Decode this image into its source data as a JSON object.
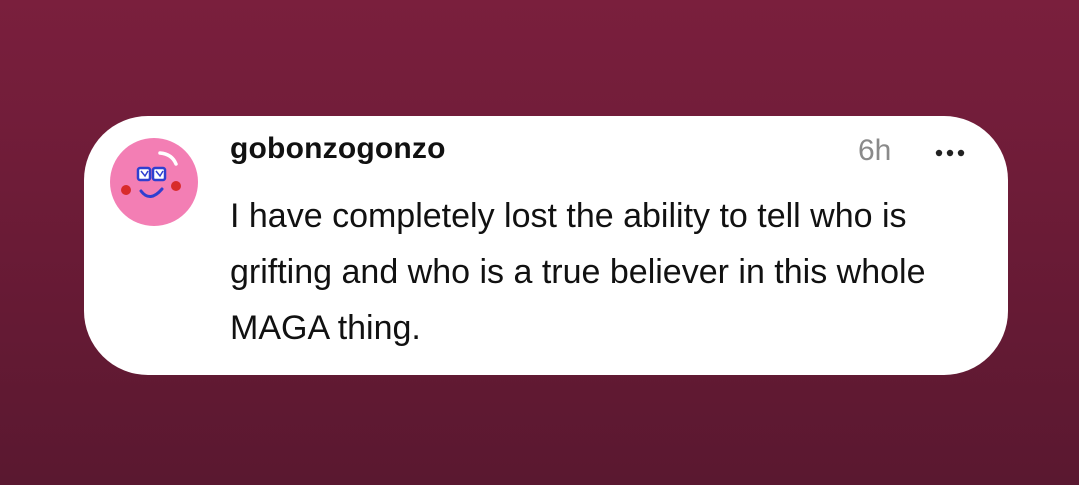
{
  "comment": {
    "username": "gobonzogonzo",
    "timestamp": "6h",
    "text": "I have completely lost the ability to tell who is grifting and who is a true believer in this whole MAGA thing.",
    "avatar_icon": "smiley-face-icon",
    "more_icon": "more-options-icon"
  },
  "colors": {
    "background": "#6d1c38",
    "card": "#ffffff",
    "avatar_bg": "#f37eb4",
    "username": "#111111",
    "timestamp": "#8a8a8a"
  }
}
